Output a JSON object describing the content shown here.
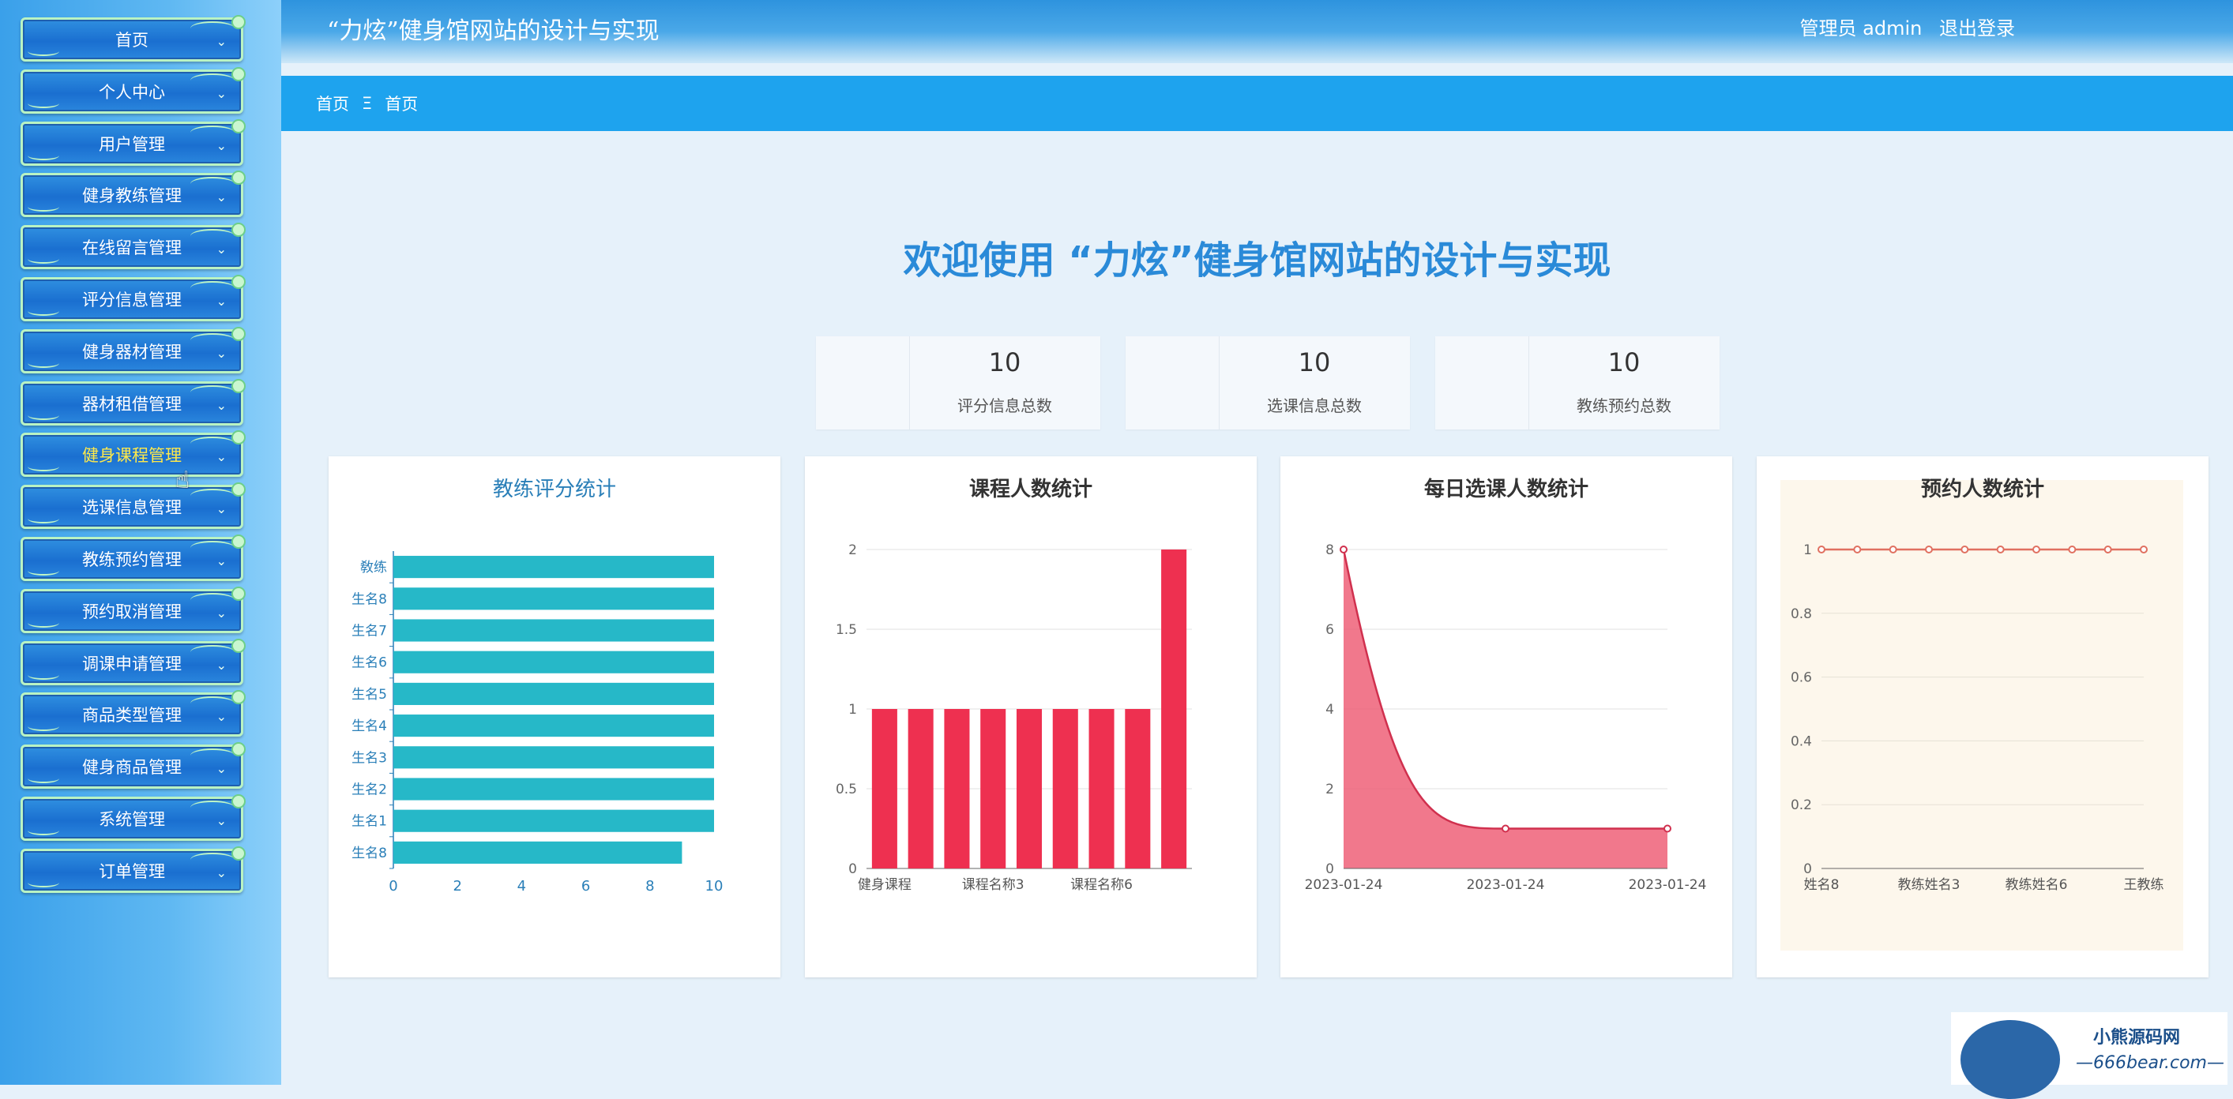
{
  "header": {
    "title": "“力炫”健身馆网站的设计与实现",
    "user_label": "管理员 admin",
    "logout_label": "退出登录"
  },
  "sidebar": {
    "items": [
      {
        "label": "首页"
      },
      {
        "label": "个人中心"
      },
      {
        "label": "用户管理"
      },
      {
        "label": "健身教练管理"
      },
      {
        "label": "在线留言管理"
      },
      {
        "label": "评分信息管理"
      },
      {
        "label": "健身器材管理"
      },
      {
        "label": "器材租借管理"
      },
      {
        "label": "健身课程管理"
      },
      {
        "label": "选课信息管理"
      },
      {
        "label": "教练预约管理"
      },
      {
        "label": "预约取消管理"
      },
      {
        "label": "调课申请管理"
      },
      {
        "label": "商品类型管理"
      },
      {
        "label": "健身商品管理"
      },
      {
        "label": "系统管理"
      },
      {
        "label": "订单管理"
      }
    ],
    "active_index": 8
  },
  "breadcrumb": {
    "home": "首页",
    "separator": "Ξ",
    "current": "首页"
  },
  "welcome": "欢迎使用 “力炫”健身馆网站的设计与实现",
  "stats": [
    {
      "value": "10",
      "label": "评分信息总数"
    },
    {
      "value": "10",
      "label": "选课信息总数"
    },
    {
      "value": "10",
      "label": "教练预约总数"
    }
  ],
  "watermark": {
    "line1": "小熊源码网",
    "line2": "—666bear.com—"
  },
  "chart_data": [
    {
      "type": "bar",
      "orientation": "horizontal",
      "title": "教练评分统计",
      "color": "#26b8c8",
      "categories": [
        "生名8",
        "生名1",
        "生名2",
        "生名3",
        "生名4",
        "生名5",
        "生名6",
        "生名7",
        "生名8",
        "敎练"
      ],
      "values": [
        9,
        10,
        10,
        10,
        10,
        10,
        10,
        10,
        10,
        10
      ],
      "xlim": [
        0,
        10
      ],
      "xticks": [
        "0",
        "2",
        "4",
        "6",
        "8",
        "10"
      ]
    },
    {
      "type": "bar",
      "title": "课程人数统计",
      "color": "#ee3050",
      "categories": [
        "健身课程",
        "",
        "",
        "课程名称3",
        "",
        "",
        "课程名称6",
        "",
        ""
      ],
      "values": [
        1,
        1,
        1,
        1,
        1,
        1,
        1,
        1,
        2
      ],
      "ylim": [
        0,
        2
      ],
      "yticks": [
        "0",
        "0.5",
        "1",
        "1.5",
        "2"
      ]
    },
    {
      "type": "area",
      "title": "每日选课人数统计",
      "color": "#ee5a73",
      "x": [
        "2023-01-24",
        "2023-01-24",
        "2023-01-24"
      ],
      "values": [
        8,
        1,
        1
      ],
      "ylim": [
        0,
        8
      ],
      "yticks": [
        "0",
        "2",
        "4",
        "6",
        "8"
      ]
    },
    {
      "type": "line",
      "title": "预约人数统计",
      "color": "#e07060",
      "x": [
        "姓名8",
        "",
        "",
        "教练姓名3",
        "",
        "",
        "教练姓名6",
        "",
        "",
        "王教练"
      ],
      "xtick_labels": [
        "姓名8",
        "教练姓名3",
        "教练姓名6",
        "王教练"
      ],
      "values": [
        1,
        1,
        1,
        1,
        1,
        1,
        1,
        1,
        1,
        1
      ],
      "ylim": [
        0,
        1
      ],
      "yticks": [
        "0",
        "0.2",
        "0.4",
        "0.6",
        "0.8",
        "1"
      ]
    }
  ]
}
